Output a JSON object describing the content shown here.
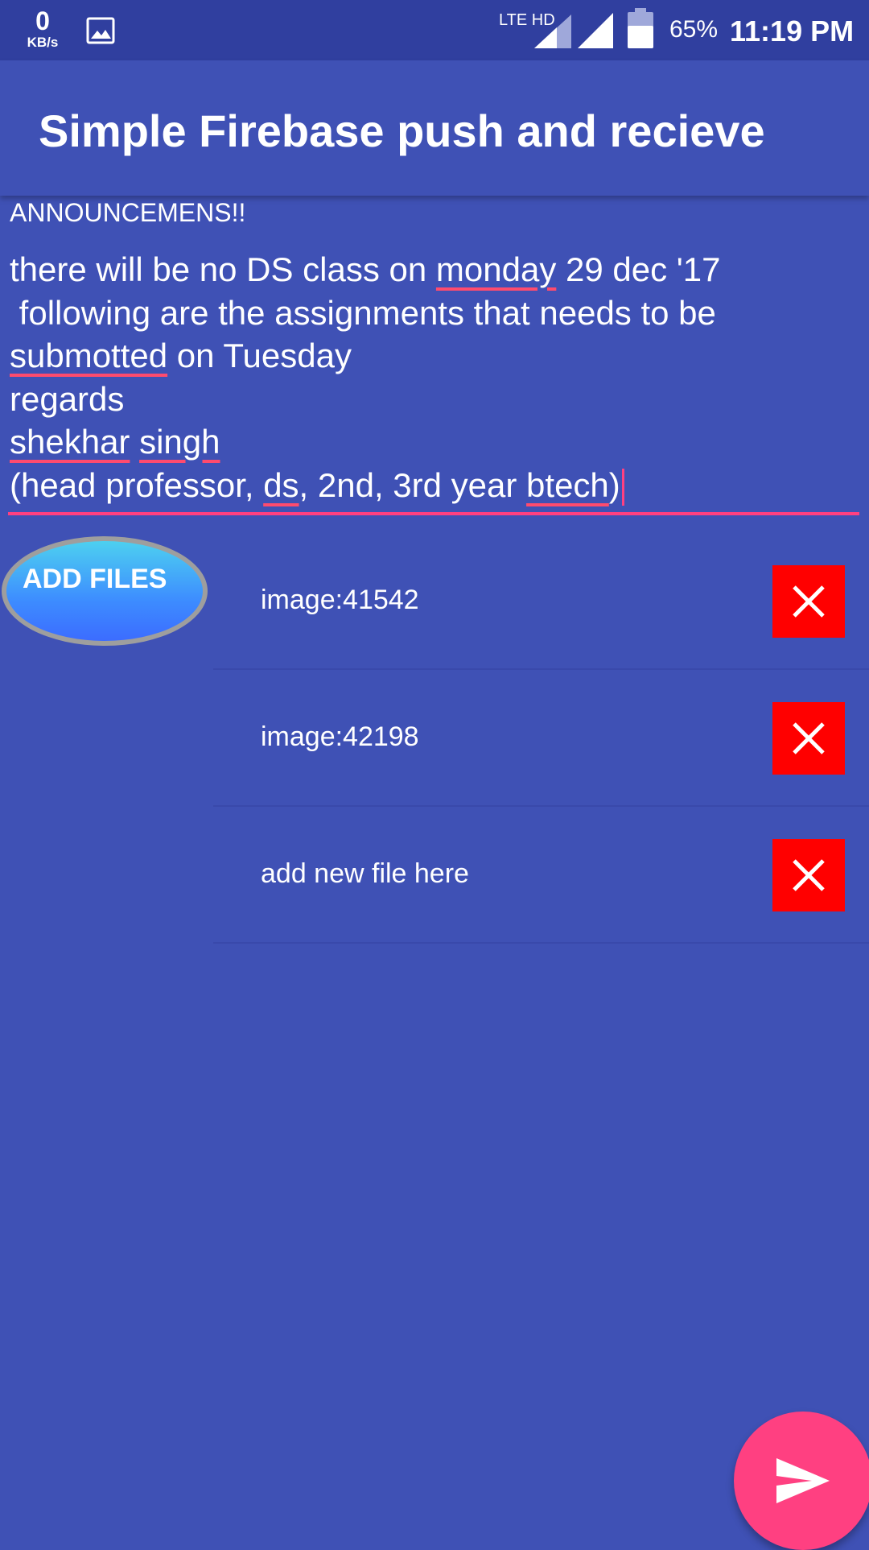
{
  "status_bar": {
    "net_speed_value": "0",
    "net_speed_unit": "KB/s",
    "network_label": "LTE HD",
    "battery_percent": "65%",
    "time": "11:19 PM",
    "icons": [
      "gallery-icon",
      "signal-icon",
      "signal-icon",
      "battery-icon"
    ]
  },
  "app_bar": {
    "title": "Simple Firebase push and recieve"
  },
  "announcement": {
    "label": "ANNOUNCEMENS!!",
    "message_lines": [
      [
        "there will be no DS class on ",
        {
          "spell": "monday"
        },
        " 29 dec '17"
      ],
      [
        " following are the assignments that needs to be"
      ],
      [
        {
          "spell": "submotted"
        },
        " on Tuesday"
      ],
      [
        "regards"
      ],
      [
        {
          "spell": "shekhar"
        },
        " ",
        {
          "spell": "singh"
        }
      ],
      [
        "(head professor, ",
        {
          "spell": "ds"
        },
        ", 2nd, 3rd year ",
        {
          "spell": "btech"
        },
        ")"
      ]
    ]
  },
  "files": {
    "add_button_label": "ADD FILES",
    "items": [
      {
        "name": "image:41542"
      },
      {
        "name": "image:42198"
      },
      {
        "name": "add new file here"
      }
    ],
    "remove_icon": "close-icon"
  },
  "send_button": {
    "icon": "send-icon"
  },
  "colors": {
    "background": "#3f51b5",
    "status_bar": "#303f9f",
    "accent": "#ff4081",
    "remove_button": "#ff0000",
    "add_files_gradient_top": "#4dd0f0",
    "add_files_gradient_bottom": "#3c6cff"
  }
}
